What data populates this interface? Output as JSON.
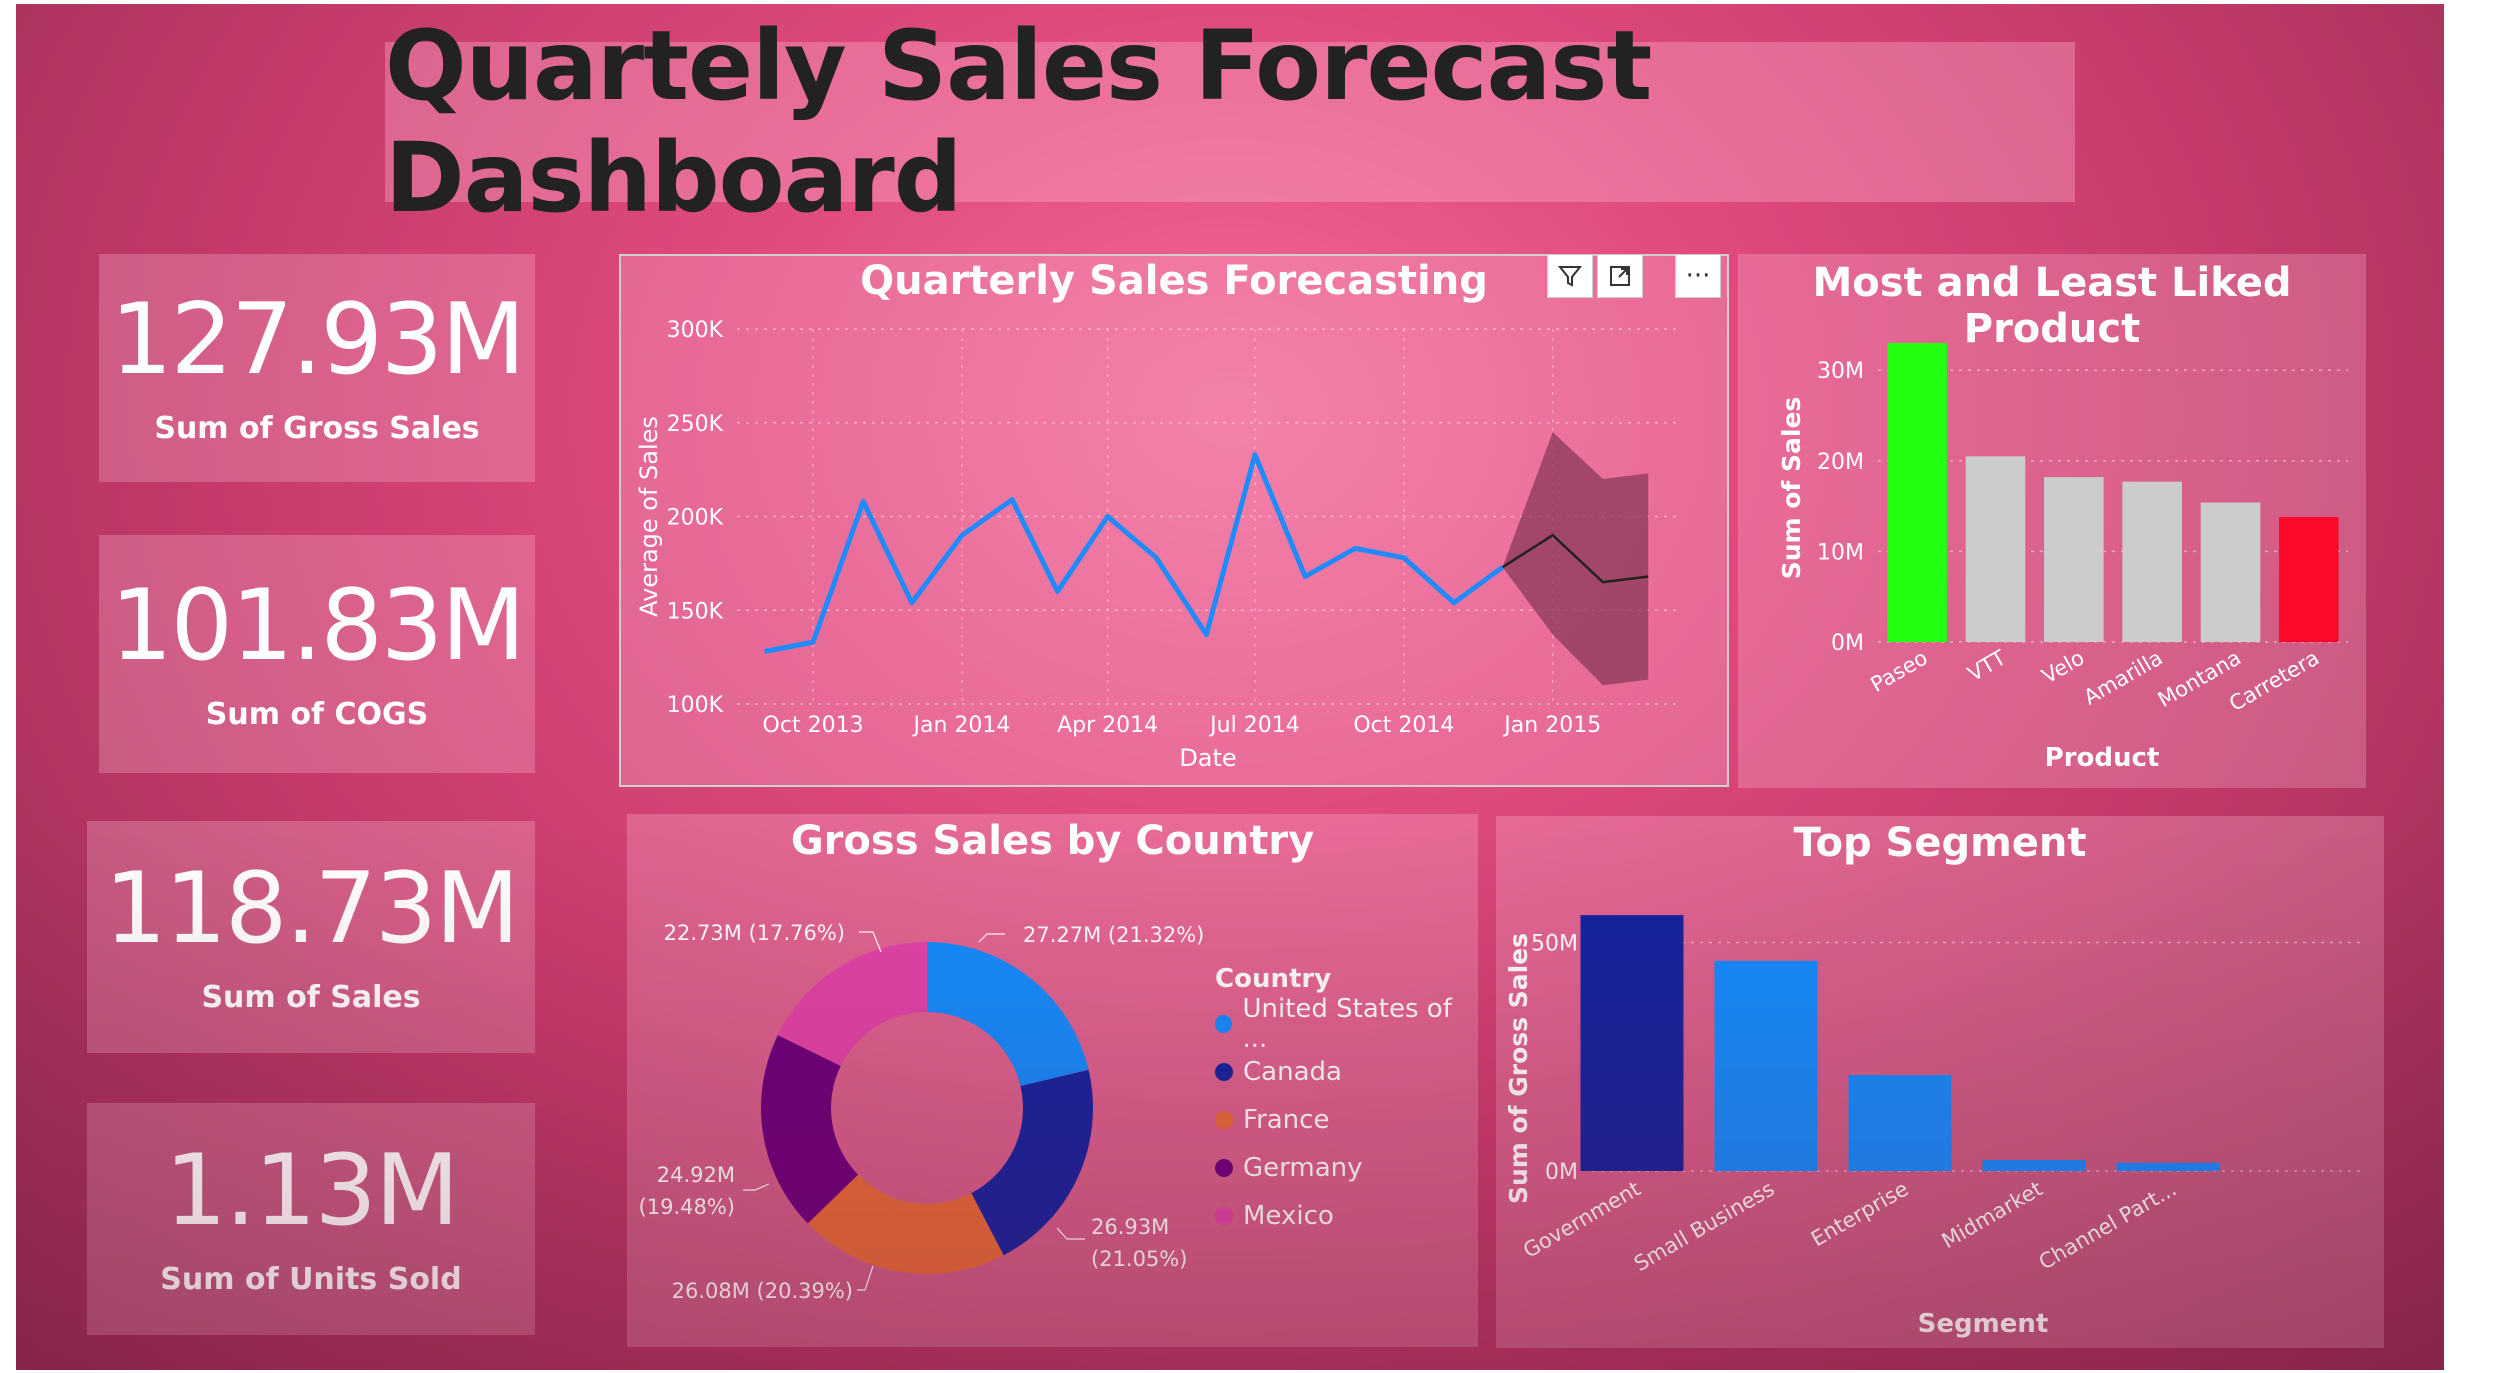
{
  "dashboard": {
    "title": "Quartely Sales Forecast Dashboard"
  },
  "kpis": [
    {
      "value": "127.93M",
      "label": "Sum of Gross Sales"
    },
    {
      "value": "101.83M",
      "label": "Sum of COGS"
    },
    {
      "value": "118.73M",
      "label": "Sum of Sales"
    },
    {
      "value": "1.13M",
      "label": "Sum of Units Sold"
    }
  ],
  "visual_header": {
    "filter_icon": "filter-icon",
    "focus_icon": "focus-mode-icon",
    "more_icon": "more-options-icon",
    "more_label": "···"
  },
  "colors": {
    "line": "#1f8bff",
    "forecast": "#222222",
    "band": "#8a3a5a",
    "highlight_max": "#22ff11",
    "highlight_min": "#ff0a28",
    "neutral_bar": "#cccccc",
    "us": "#118dff",
    "canada": "#12239e",
    "france": "#e66c37",
    "germany": "#6b007b",
    "mexico": "#e044a7"
  },
  "chart_data": [
    {
      "type": "line",
      "title": "Quarterly Sales Forecasting",
      "xlabel": "Date",
      "ylabel": "Average of Sales",
      "ylim": [
        100000,
        300000
      ],
      "yticks": [
        "100K",
        "150K",
        "200K",
        "250K",
        "300K"
      ],
      "xticks": [
        "Oct 2013",
        "Jan 2014",
        "Apr 2014",
        "Jul 2014",
        "Oct 2014",
        "Jan 2015"
      ],
      "grid": true,
      "series": [
        {
          "x": [
            "2013-09-01",
            "2013-10-01",
            "2013-11-01",
            "2013-12-01",
            "2014-01-01",
            "2014-02-01",
            "2014-03-01",
            "2014-04-01",
            "2014-05-01",
            "2014-06-01",
            "2014-07-01",
            "2014-08-01",
            "2014-09-01",
            "2014-10-01",
            "2014-11-01",
            "2014-12-01"
          ],
          "values": [
            128000,
            133000,
            208000,
            154000,
            190000,
            209000,
            160000,
            200000,
            178000,
            137000,
            233000,
            168000,
            183000,
            178000,
            154000,
            173000
          ]
        }
      ],
      "forecast": {
        "x": [
          "2014-12-01",
          "2015-01-01",
          "2015-02-01",
          "2015-03-01"
        ],
        "values": [
          173000,
          190000,
          165000,
          168000
        ],
        "upper": [
          173000,
          245000,
          220000,
          223000
        ],
        "lower": [
          173000,
          137000,
          110000,
          113000
        ]
      }
    },
    {
      "type": "bar",
      "title": "Most and Least Liked Product",
      "xlabel": "Product",
      "ylabel": "Sum of Sales",
      "categories": [
        "Paseo",
        "VTT",
        "Velo",
        "Amarilla",
        "Montana",
        "Carretera"
      ],
      "values": [
        33000000,
        20500000,
        18200000,
        17700000,
        15400000,
        13800000
      ],
      "ylim": [
        0,
        34000000
      ],
      "yticks": [
        "0M",
        "10M",
        "20M",
        "30M"
      ],
      "grid": true
    },
    {
      "type": "pie",
      "title": "Gross Sales by Country",
      "legend_title": "Country",
      "legend_position": "right",
      "slices": [
        {
          "name": "United States of ...",
          "value": 27.27,
          "label": "27.27M (21.32%)"
        },
        {
          "name": "Canada",
          "value": 26.93,
          "label_value": "26.93M",
          "label_pct": "(21.05%)"
        },
        {
          "name": "France",
          "value": 26.08,
          "label": "26.08M (20.39%)"
        },
        {
          "name": "Germany",
          "value": 24.92,
          "label_value": "24.92M",
          "label_pct": "(19.48%)"
        },
        {
          "name": "Mexico",
          "value": 22.73,
          "label": "22.73M (17.76%)"
        }
      ]
    },
    {
      "type": "bar",
      "title": "Top Segment",
      "xlabel": "Segment",
      "ylabel": "Sum of Gross Sales",
      "categories": [
        "Government",
        "Small Business",
        "Enterprise",
        "Midmarket",
        "Channel Part..."
      ],
      "values": [
        56000000,
        46000000,
        21000000,
        2400000,
        1800000
      ],
      "ylim": [
        0,
        58000000
      ],
      "yticks": [
        "0M",
        "50M"
      ],
      "grid": true
    }
  ]
}
